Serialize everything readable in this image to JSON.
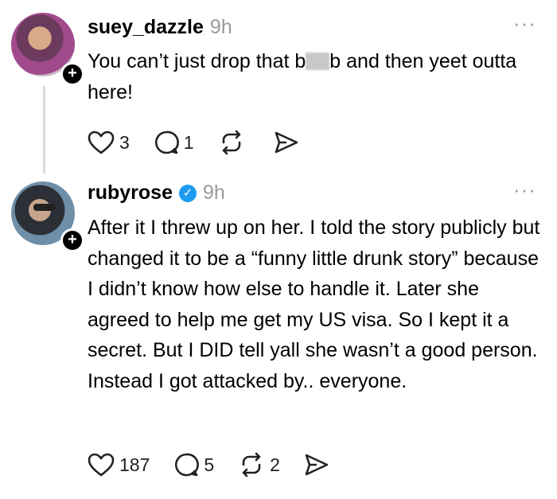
{
  "posts": [
    {
      "username": "suey_dazzle",
      "time": "9h",
      "verified": false,
      "text_before_censor": "You can’t just drop that b",
      "text_after_censor": "b and then yeet outta here!",
      "likes": "3",
      "replies": "1",
      "reposts": "",
      "icons": [
        "heart-icon",
        "comment-icon",
        "repost-icon",
        "share-icon"
      ]
    },
    {
      "username": "rubyrose",
      "time": "9h",
      "verified": true,
      "text": "After it I threw up on her. I told the story publicly but changed it to be a “funny little drunk story” because I didn’t know how else to handle it. Later she agreed to help me get my US visa. So I kept it a secret. But I DID tell yall she wasn’t a good person. Instead I got attacked by.. everyone.",
      "likes": "187",
      "replies": "5",
      "reposts": "2",
      "icons": [
        "heart-icon",
        "comment-icon",
        "repost-icon",
        "share-icon"
      ]
    }
  ],
  "glyphs": {
    "more": "···",
    "plus": "+",
    "check": "✓"
  },
  "colors": {
    "verified": "#1d9bf0",
    "muted": "#999999",
    "thread_line": "#d9d9d9"
  }
}
